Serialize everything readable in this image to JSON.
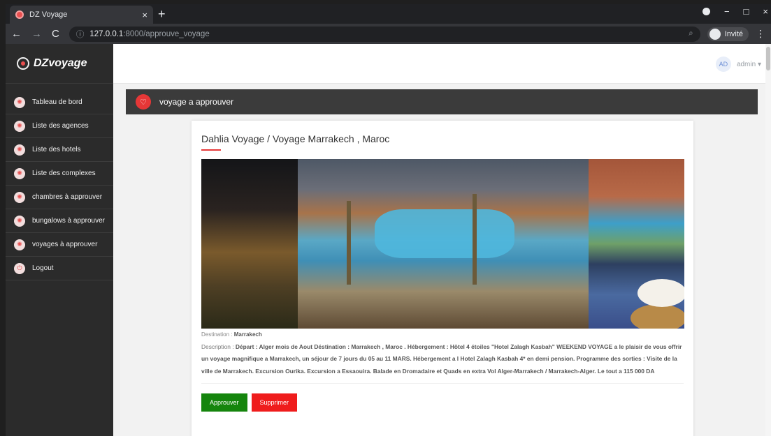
{
  "browser": {
    "tab_title": "DZ Voyage",
    "tab_close": "×",
    "new_tab": "+",
    "url_host": "127.0.0.1",
    "url_path": ":8000/approuve_voyage",
    "profile_label": "Invité",
    "window_controls": {
      "minimize": "−",
      "maximize": "□",
      "close": "×"
    }
  },
  "sidebar": {
    "brand": "DZvoyage",
    "items": [
      {
        "label": "Tableau de bord",
        "icon": "sun-icon"
      },
      {
        "label": "Liste des agences",
        "icon": "sun-icon"
      },
      {
        "label": "Liste des hotels",
        "icon": "sun-icon"
      },
      {
        "label": "Liste des complexes",
        "icon": "sun-icon"
      },
      {
        "label": "chambres à approuver",
        "icon": "sun-icon"
      },
      {
        "label": "bungalows à approuver",
        "icon": "sun-icon"
      },
      {
        "label": "voyages à approuver",
        "icon": "sun-icon"
      },
      {
        "label": "Logout",
        "icon": "power-icon"
      }
    ]
  },
  "topbar": {
    "avatar_initials": "AD",
    "username": "admin"
  },
  "page": {
    "title": "voyage a approuver"
  },
  "voyage": {
    "title": "Dahlia Voyage / Voyage Marrakech , Maroc",
    "destination_label": "Destination : ",
    "destination": "Marrakech",
    "description_label": "Description : ",
    "description": "Départ : Alger mois de Aout Déstination : Marrakech , Maroc . Hébergement : Hôtel 4 étoiles \"Hotel Zalagh Kasbah\" WEEKEND VOYAGE a le plaisir de vous offrir un voyage magnifique a Marrakech, un séjour de 7 jours du 05 au 11 MARS. Hébergement a l Hotel Zalagh Kasbah 4* en demi pension. Programme des sorties : Visite de la ville de Marrakech. Excursion Ourika. Excursion a Essaouira. Balade en Dromadaire et Quads en extra Vol Alger-Marrakech / Marrakech-Alger. Le tout a 115 000 DA",
    "approve_label": "Approuver",
    "delete_label": "Supprimer"
  },
  "colors": {
    "sidebar_bg": "#2b2b2b",
    "accent_red": "#e63737",
    "approve_green": "#15850d",
    "delete_red": "#ef1c1c"
  }
}
